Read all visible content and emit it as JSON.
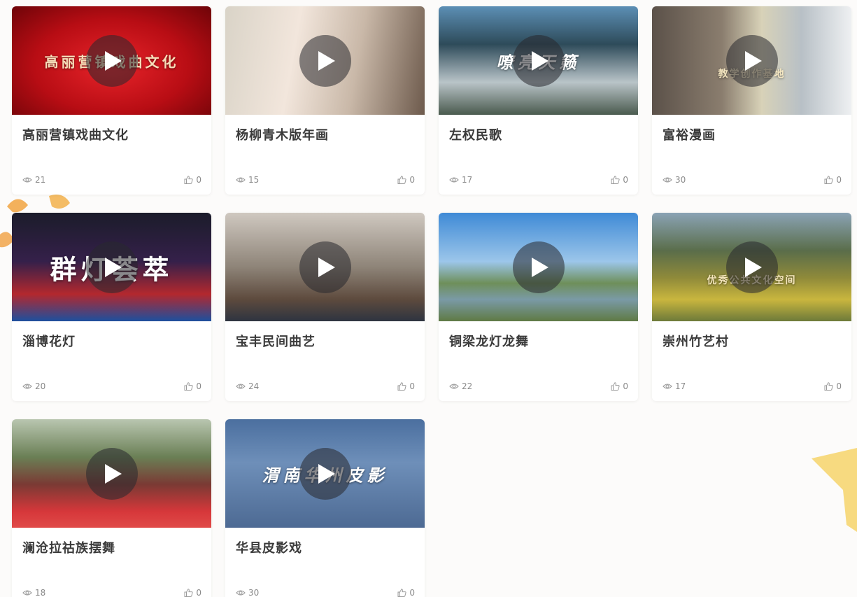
{
  "videos": [
    {
      "title": "高丽营镇戏曲文化",
      "views": "21",
      "likes": "0",
      "thumb_text": "高丽营镇戏曲文化",
      "bg": "radial-gradient(ellipse at 50% 55%, #e8242a 0%, #b80d14 55%, #6e0408 100%)"
    },
    {
      "title": "杨柳青木版年画",
      "views": "15",
      "likes": "0",
      "thumb_text": "",
      "bg": "linear-gradient(100deg, #d9d3c7 0%, #f2e6dc 35%, #c9b8a8 65%, #6d5a4c 100%)"
    },
    {
      "title": "左权民歌",
      "views": "17",
      "likes": "0",
      "thumb_text": "嘹亮天籁",
      "bg": "linear-gradient(180deg, #5c8fb5 0%, #2e4b5a 35%, #b9c4c8 70%, #4a5a4e 100%)"
    },
    {
      "title": "富裕漫画",
      "views": "30",
      "likes": "0",
      "thumb_text": "教学创作基地",
      "bg": "linear-gradient(90deg, #5b5149 0%, #8a7d6e 35%, #d8d2b8 55%, #b8c0c6 75%, #eef0f2 100%)"
    },
    {
      "title": "淄博花灯",
      "views": "20",
      "likes": "0",
      "thumb_text": "群灯荟萃",
      "bg": "linear-gradient(180deg, #1b1c2a 0%, #35204a 45%, #b3282e 75%, #1d4f9e 100%)"
    },
    {
      "title": "宝丰民间曲艺",
      "views": "24",
      "likes": "0",
      "thumb_text": "",
      "bg": "linear-gradient(180deg, #cfc8c0 0%, #8e8478 50%, #5d4a3d 80%, #2e3440 100%)"
    },
    {
      "title": "铜梁龙灯龙舞",
      "views": "22",
      "likes": "0",
      "thumb_text": "",
      "bg": "linear-gradient(180deg, #3f8ad6 0%, #9cc6ea 45%, #6e8f5a 65%, #7a9aa6 80%, #5f7a44 100%)"
    },
    {
      "title": "崇州竹艺村",
      "views": "17",
      "likes": "0",
      "thumb_text": "优秀公共文化空间",
      "bg": "linear-gradient(180deg, #8aa3b5 0%, #5a6d4a 35%, #8f8a3a 60%, #c9b63e 80%, #6d7a3a 100%)"
    },
    {
      "title": "澜沧拉祜族摆舞",
      "views": "18",
      "likes": "0",
      "thumb_text": "",
      "bg": "linear-gradient(180deg, #b9c6b0 0%, #6a7f55 35%, #7a3a34 60%, #d6373a 85%, #e04a48 100%)"
    },
    {
      "title": "华县皮影戏",
      "views": "30",
      "likes": "0",
      "thumb_text": "渭南华州皮影",
      "bg": "linear-gradient(180deg, #4b6f9f 0%, #6e8fb9 40%, #4d6a93 100%)"
    }
  ],
  "colors": {
    "accent": "#e8242a",
    "title": "#3a3a3a",
    "meta": "#8a8a8a",
    "background": "#fcfbfa"
  },
  "icons": {
    "views": "eye-icon",
    "likes": "thumbs-up-icon",
    "play": "play-icon"
  }
}
